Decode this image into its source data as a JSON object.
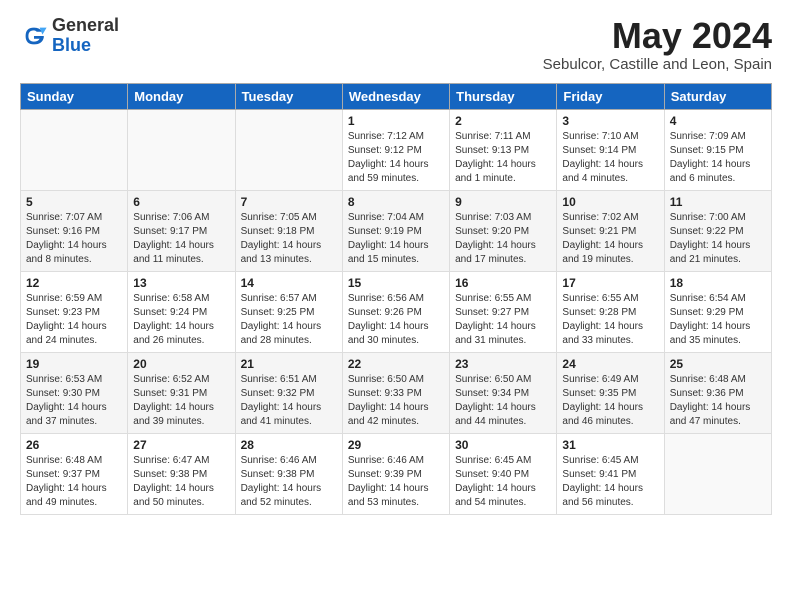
{
  "logo": {
    "general": "General",
    "blue": "Blue"
  },
  "title": "May 2024",
  "location": "Sebulcor, Castille and Leon, Spain",
  "headers": [
    "Sunday",
    "Monday",
    "Tuesday",
    "Wednesday",
    "Thursday",
    "Friday",
    "Saturday"
  ],
  "weeks": [
    [
      {
        "day": "",
        "sunrise": "",
        "sunset": "",
        "daylight": ""
      },
      {
        "day": "",
        "sunrise": "",
        "sunset": "",
        "daylight": ""
      },
      {
        "day": "",
        "sunrise": "",
        "sunset": "",
        "daylight": ""
      },
      {
        "day": "1",
        "sunrise": "Sunrise: 7:12 AM",
        "sunset": "Sunset: 9:12 PM",
        "daylight": "Daylight: 14 hours and 59 minutes."
      },
      {
        "day": "2",
        "sunrise": "Sunrise: 7:11 AM",
        "sunset": "Sunset: 9:13 PM",
        "daylight": "Daylight: 14 hours and 1 minute."
      },
      {
        "day": "3",
        "sunrise": "Sunrise: 7:10 AM",
        "sunset": "Sunset: 9:14 PM",
        "daylight": "Daylight: 14 hours and 4 minutes."
      },
      {
        "day": "4",
        "sunrise": "Sunrise: 7:09 AM",
        "sunset": "Sunset: 9:15 PM",
        "daylight": "Daylight: 14 hours and 6 minutes."
      }
    ],
    [
      {
        "day": "5",
        "sunrise": "Sunrise: 7:07 AM",
        "sunset": "Sunset: 9:16 PM",
        "daylight": "Daylight: 14 hours and 8 minutes."
      },
      {
        "day": "6",
        "sunrise": "Sunrise: 7:06 AM",
        "sunset": "Sunset: 9:17 PM",
        "daylight": "Daylight: 14 hours and 11 minutes."
      },
      {
        "day": "7",
        "sunrise": "Sunrise: 7:05 AM",
        "sunset": "Sunset: 9:18 PM",
        "daylight": "Daylight: 14 hours and 13 minutes."
      },
      {
        "day": "8",
        "sunrise": "Sunrise: 7:04 AM",
        "sunset": "Sunset: 9:19 PM",
        "daylight": "Daylight: 14 hours and 15 minutes."
      },
      {
        "day": "9",
        "sunrise": "Sunrise: 7:03 AM",
        "sunset": "Sunset: 9:20 PM",
        "daylight": "Daylight: 14 hours and 17 minutes."
      },
      {
        "day": "10",
        "sunrise": "Sunrise: 7:02 AM",
        "sunset": "Sunset: 9:21 PM",
        "daylight": "Daylight: 14 hours and 19 minutes."
      },
      {
        "day": "11",
        "sunrise": "Sunrise: 7:00 AM",
        "sunset": "Sunset: 9:22 PM",
        "daylight": "Daylight: 14 hours and 21 minutes."
      }
    ],
    [
      {
        "day": "12",
        "sunrise": "Sunrise: 6:59 AM",
        "sunset": "Sunset: 9:23 PM",
        "daylight": "Daylight: 14 hours and 24 minutes."
      },
      {
        "day": "13",
        "sunrise": "Sunrise: 6:58 AM",
        "sunset": "Sunset: 9:24 PM",
        "daylight": "Daylight: 14 hours and 26 minutes."
      },
      {
        "day": "14",
        "sunrise": "Sunrise: 6:57 AM",
        "sunset": "Sunset: 9:25 PM",
        "daylight": "Daylight: 14 hours and 28 minutes."
      },
      {
        "day": "15",
        "sunrise": "Sunrise: 6:56 AM",
        "sunset": "Sunset: 9:26 PM",
        "daylight": "Daylight: 14 hours and 30 minutes."
      },
      {
        "day": "16",
        "sunrise": "Sunrise: 6:55 AM",
        "sunset": "Sunset: 9:27 PM",
        "daylight": "Daylight: 14 hours and 31 minutes."
      },
      {
        "day": "17",
        "sunrise": "Sunrise: 6:55 AM",
        "sunset": "Sunset: 9:28 PM",
        "daylight": "Daylight: 14 hours and 33 minutes."
      },
      {
        "day": "18",
        "sunrise": "Sunrise: 6:54 AM",
        "sunset": "Sunset: 9:29 PM",
        "daylight": "Daylight: 14 hours and 35 minutes."
      }
    ],
    [
      {
        "day": "19",
        "sunrise": "Sunrise: 6:53 AM",
        "sunset": "Sunset: 9:30 PM",
        "daylight": "Daylight: 14 hours and 37 minutes."
      },
      {
        "day": "20",
        "sunrise": "Sunrise: 6:52 AM",
        "sunset": "Sunset: 9:31 PM",
        "daylight": "Daylight: 14 hours and 39 minutes."
      },
      {
        "day": "21",
        "sunrise": "Sunrise: 6:51 AM",
        "sunset": "Sunset: 9:32 PM",
        "daylight": "Daylight: 14 hours and 41 minutes."
      },
      {
        "day": "22",
        "sunrise": "Sunrise: 6:50 AM",
        "sunset": "Sunset: 9:33 PM",
        "daylight": "Daylight: 14 hours and 42 minutes."
      },
      {
        "day": "23",
        "sunrise": "Sunrise: 6:50 AM",
        "sunset": "Sunset: 9:34 PM",
        "daylight": "Daylight: 14 hours and 44 minutes."
      },
      {
        "day": "24",
        "sunrise": "Sunrise: 6:49 AM",
        "sunset": "Sunset: 9:35 PM",
        "daylight": "Daylight: 14 hours and 46 minutes."
      },
      {
        "day": "25",
        "sunrise": "Sunrise: 6:48 AM",
        "sunset": "Sunset: 9:36 PM",
        "daylight": "Daylight: 14 hours and 47 minutes."
      }
    ],
    [
      {
        "day": "26",
        "sunrise": "Sunrise: 6:48 AM",
        "sunset": "Sunset: 9:37 PM",
        "daylight": "Daylight: 14 hours and 49 minutes."
      },
      {
        "day": "27",
        "sunrise": "Sunrise: 6:47 AM",
        "sunset": "Sunset: 9:38 PM",
        "daylight": "Daylight: 14 hours and 50 minutes."
      },
      {
        "day": "28",
        "sunrise": "Sunrise: 6:46 AM",
        "sunset": "Sunset: 9:38 PM",
        "daylight": "Daylight: 14 hours and 52 minutes."
      },
      {
        "day": "29",
        "sunrise": "Sunrise: 6:46 AM",
        "sunset": "Sunset: 9:39 PM",
        "daylight": "Daylight: 14 hours and 53 minutes."
      },
      {
        "day": "30",
        "sunrise": "Sunrise: 6:45 AM",
        "sunset": "Sunset: 9:40 PM",
        "daylight": "Daylight: 14 hours and 54 minutes."
      },
      {
        "day": "31",
        "sunrise": "Sunrise: 6:45 AM",
        "sunset": "Sunset: 9:41 PM",
        "daylight": "Daylight: 14 hours and 56 minutes."
      },
      {
        "day": "",
        "sunrise": "",
        "sunset": "",
        "daylight": ""
      }
    ]
  ]
}
